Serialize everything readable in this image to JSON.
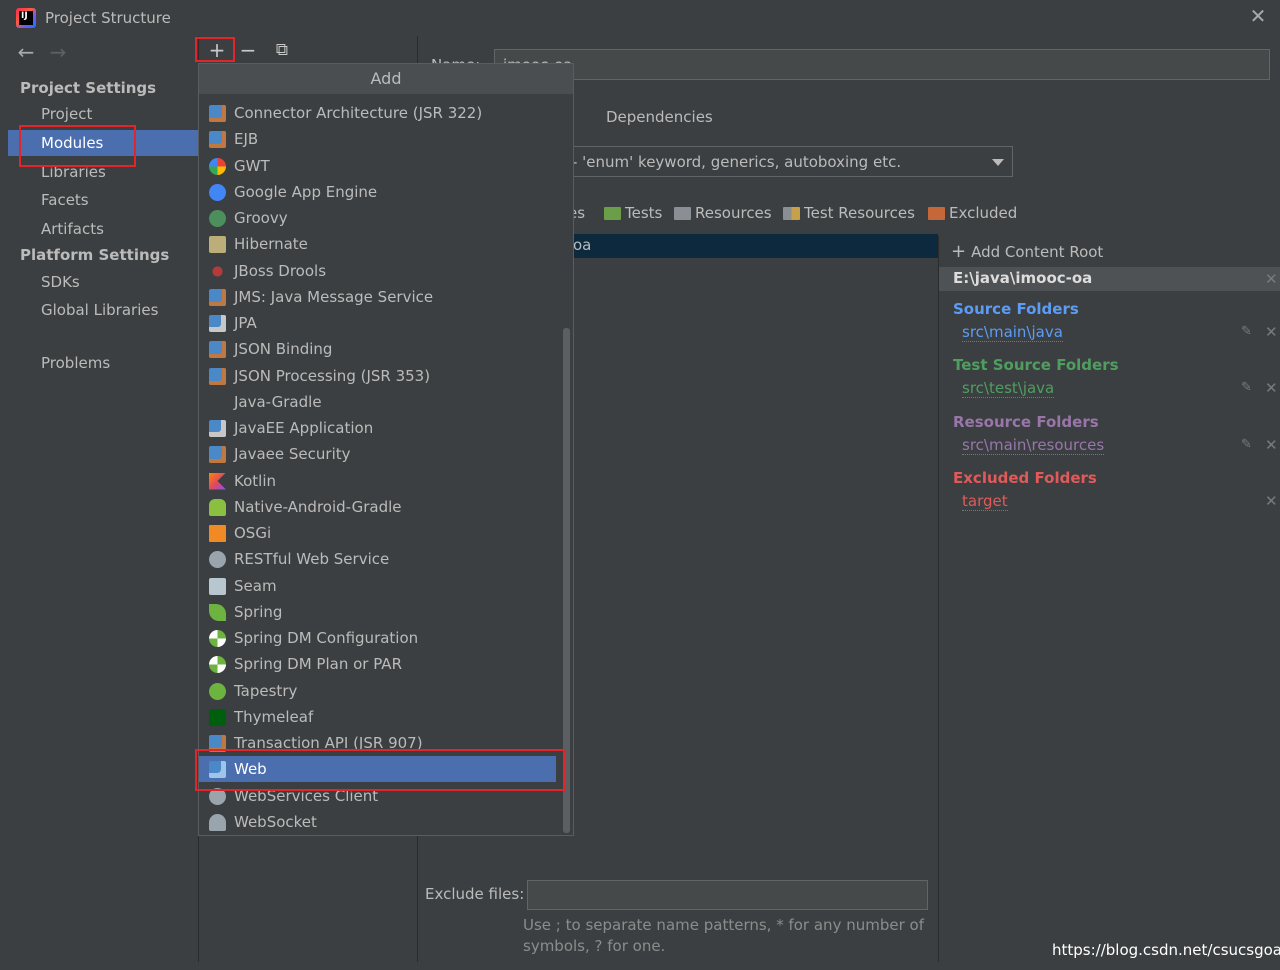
{
  "window": {
    "title": "Project Structure",
    "close_glyph": "✕"
  },
  "sidebar": {
    "back_glyph": "←",
    "forward_glyph": "→",
    "project_settings_heading": "Project Settings",
    "platform_settings_heading": "Platform Settings",
    "items": [
      {
        "label": "Project",
        "selected": false
      },
      {
        "label": "Modules",
        "selected": true
      },
      {
        "label": "Libraries",
        "selected": false
      },
      {
        "label": "Facets",
        "selected": false
      },
      {
        "label": "Artifacts",
        "selected": false
      },
      {
        "label": "SDKs",
        "selected": false
      },
      {
        "label": "Global Libraries",
        "selected": false
      },
      {
        "label": "Problems",
        "selected": false
      }
    ]
  },
  "toolbar": {
    "add_glyph": "+",
    "remove_glyph": "−",
    "copy_glyph": "⧉"
  },
  "popup": {
    "title": "Add",
    "items": [
      {
        "label": "Connector Architecture (JSR 322)",
        "icon": "jee-module-icon"
      },
      {
        "label": "EJB",
        "icon": "jee-module-icon"
      },
      {
        "label": "GWT",
        "icon": "google-icon"
      },
      {
        "label": "Google App Engine",
        "icon": "app-engine-icon"
      },
      {
        "label": "Groovy",
        "icon": "groovy-icon"
      },
      {
        "label": "Hibernate",
        "icon": "hibernate-icon"
      },
      {
        "label": "JBoss Drools",
        "icon": "drools-icon"
      },
      {
        "label": "JMS: Java Message Service",
        "icon": "jee-module-icon"
      },
      {
        "label": "JPA",
        "icon": "jpa-icon"
      },
      {
        "label": "JSON Binding",
        "icon": "jee-module-icon"
      },
      {
        "label": "JSON Processing (JSR 353)",
        "icon": "jee-module-icon"
      },
      {
        "label": "Java-Gradle",
        "icon": ""
      },
      {
        "label": "JavaEE Application",
        "icon": "javaee-app-icon"
      },
      {
        "label": "Javaee Security",
        "icon": "jee-module-icon"
      },
      {
        "label": "Kotlin",
        "icon": "kotlin-icon"
      },
      {
        "label": "Native-Android-Gradle",
        "icon": "android-icon"
      },
      {
        "label": "OSGi",
        "icon": "osgi-icon"
      },
      {
        "label": "RESTful Web Service",
        "icon": "globe-icon"
      },
      {
        "label": "Seam",
        "icon": "seam-icon"
      },
      {
        "label": "Spring",
        "icon": "spring-leaf-icon"
      },
      {
        "label": "Spring DM Configuration",
        "icon": "spring-dm-icon"
      },
      {
        "label": "Spring DM Plan or PAR",
        "icon": "spring-dm-icon"
      },
      {
        "label": "Tapestry",
        "icon": "tapestry-icon"
      },
      {
        "label": "Thymeleaf",
        "icon": "thymeleaf-icon"
      },
      {
        "label": "Transaction API (JSR 907)",
        "icon": "jee-module-icon"
      },
      {
        "label": "Web",
        "icon": "web-module-icon",
        "selected": true
      },
      {
        "label": "WebServices Client",
        "icon": "webservices-icon"
      },
      {
        "label": "WebSocket",
        "icon": "websocket-icon"
      }
    ]
  },
  "main": {
    "name_label": "Name:",
    "name_value": "imooc-oa",
    "dependencies_tab": "Dependencies",
    "language_level": "- 'enum' keyword, generics, autoboxing etc.",
    "mark_as": [
      "es",
      "Tests",
      "Resources",
      "Test Resources",
      "Excluded"
    ],
    "tree_selected": "oa",
    "exclude_label": "Exclude files:",
    "exclude_value": "",
    "hint_line1": "Use ; to separate name patterns, * for any number of",
    "hint_line2": "symbols, ? for one."
  },
  "content_roots": {
    "add_label": "Add Content Root",
    "root_path": "E:\\java\\imooc-oa",
    "groups": [
      {
        "title": "Source Folders",
        "path": "src\\main\\java",
        "color": "#5c9cf5"
      },
      {
        "title": "Test Source Folders",
        "path": "src\\test\\java",
        "color": "#4f9e60"
      },
      {
        "title": "Resource Folders",
        "path": "src\\main\\resources",
        "color": "#9876aa"
      },
      {
        "title": "Excluded Folders",
        "path": "target",
        "color": "#e15a5a"
      }
    ]
  },
  "watermark": "https://blog.csdn.net/csucsgoat"
}
